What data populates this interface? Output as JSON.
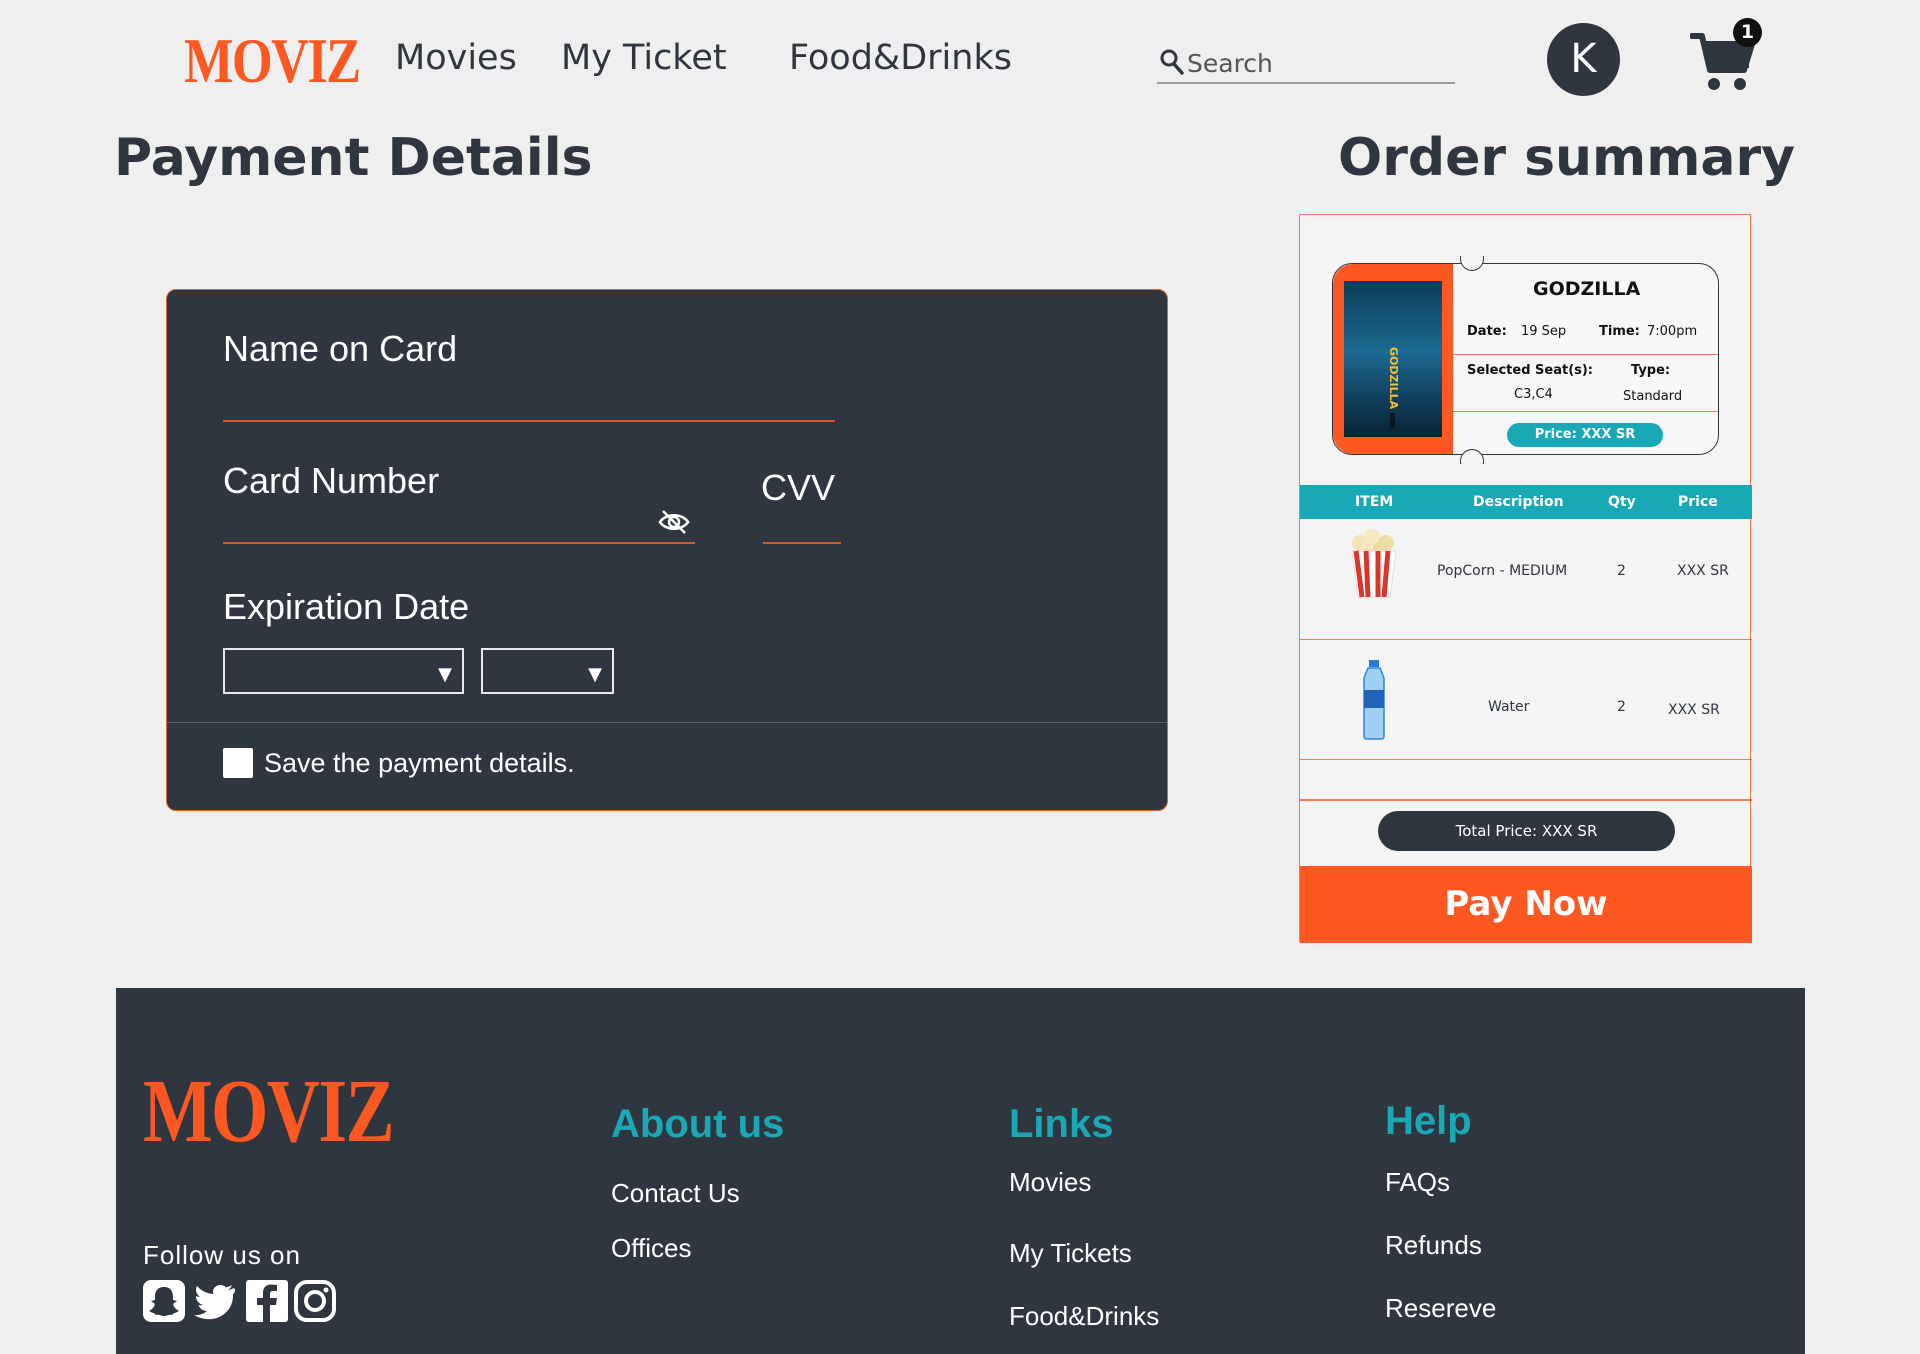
{
  "header": {
    "logo": "MOVIZ",
    "nav": [
      "Movies",
      "My Ticket",
      "Food&Drinks"
    ],
    "search_placeholder": "Search",
    "avatar_initial": "K",
    "cart_count": "1"
  },
  "payment": {
    "title": "Payment Details",
    "name_label": "Name on Card",
    "card_number_label": "Card Number",
    "cvv_label": "CVV",
    "expiration_label": "Expiration Date",
    "save_label": "Save the payment details."
  },
  "order": {
    "title": "Order summary",
    "ticket": {
      "movie": "GODZILLA",
      "poster_text": "GODZILLA",
      "date_label": "Date:",
      "date_value": "19 Sep",
      "time_label": "Time:",
      "time_value": "7:00pm",
      "seats_label": "Selected Seat(s):",
      "seats_value": "C3,C4",
      "type_label": "Type:",
      "type_value": "Standard",
      "price": "Price: XXX SR"
    },
    "table": {
      "headers": [
        "ITEM",
        "Description",
        "Qty",
        "Price"
      ],
      "rows": [
        {
          "description": "PopCorn - MEDIUM",
          "qty": "2",
          "price": "XXX SR",
          "icon": "popcorn-icon"
        },
        {
          "description": "Water",
          "qty": "2",
          "price": "XXX SR",
          "icon": "water-bottle-icon"
        }
      ]
    },
    "total": "Total Price: XXX SR",
    "pay_button": "Pay Now"
  },
  "footer": {
    "logo": "MOVIZ",
    "follow": "Follow us on",
    "about": {
      "title": "About us",
      "links": [
        "Contact Us",
        "Offices"
      ]
    },
    "links": {
      "title": "Links",
      "links": [
        "Movies",
        "My Tickets",
        "Food&Drinks"
      ]
    },
    "help": {
      "title": "Help",
      "links": [
        "FAQs",
        "Refunds",
        "Resereve"
      ]
    },
    "social_icons": [
      "snapchat-icon",
      "twitter-icon",
      "facebook-icon",
      "instagram-icon"
    ]
  },
  "colors": {
    "accent": "#fd5722",
    "teal": "#19a9b6",
    "dark": "#303640",
    "background": "#efefef"
  }
}
